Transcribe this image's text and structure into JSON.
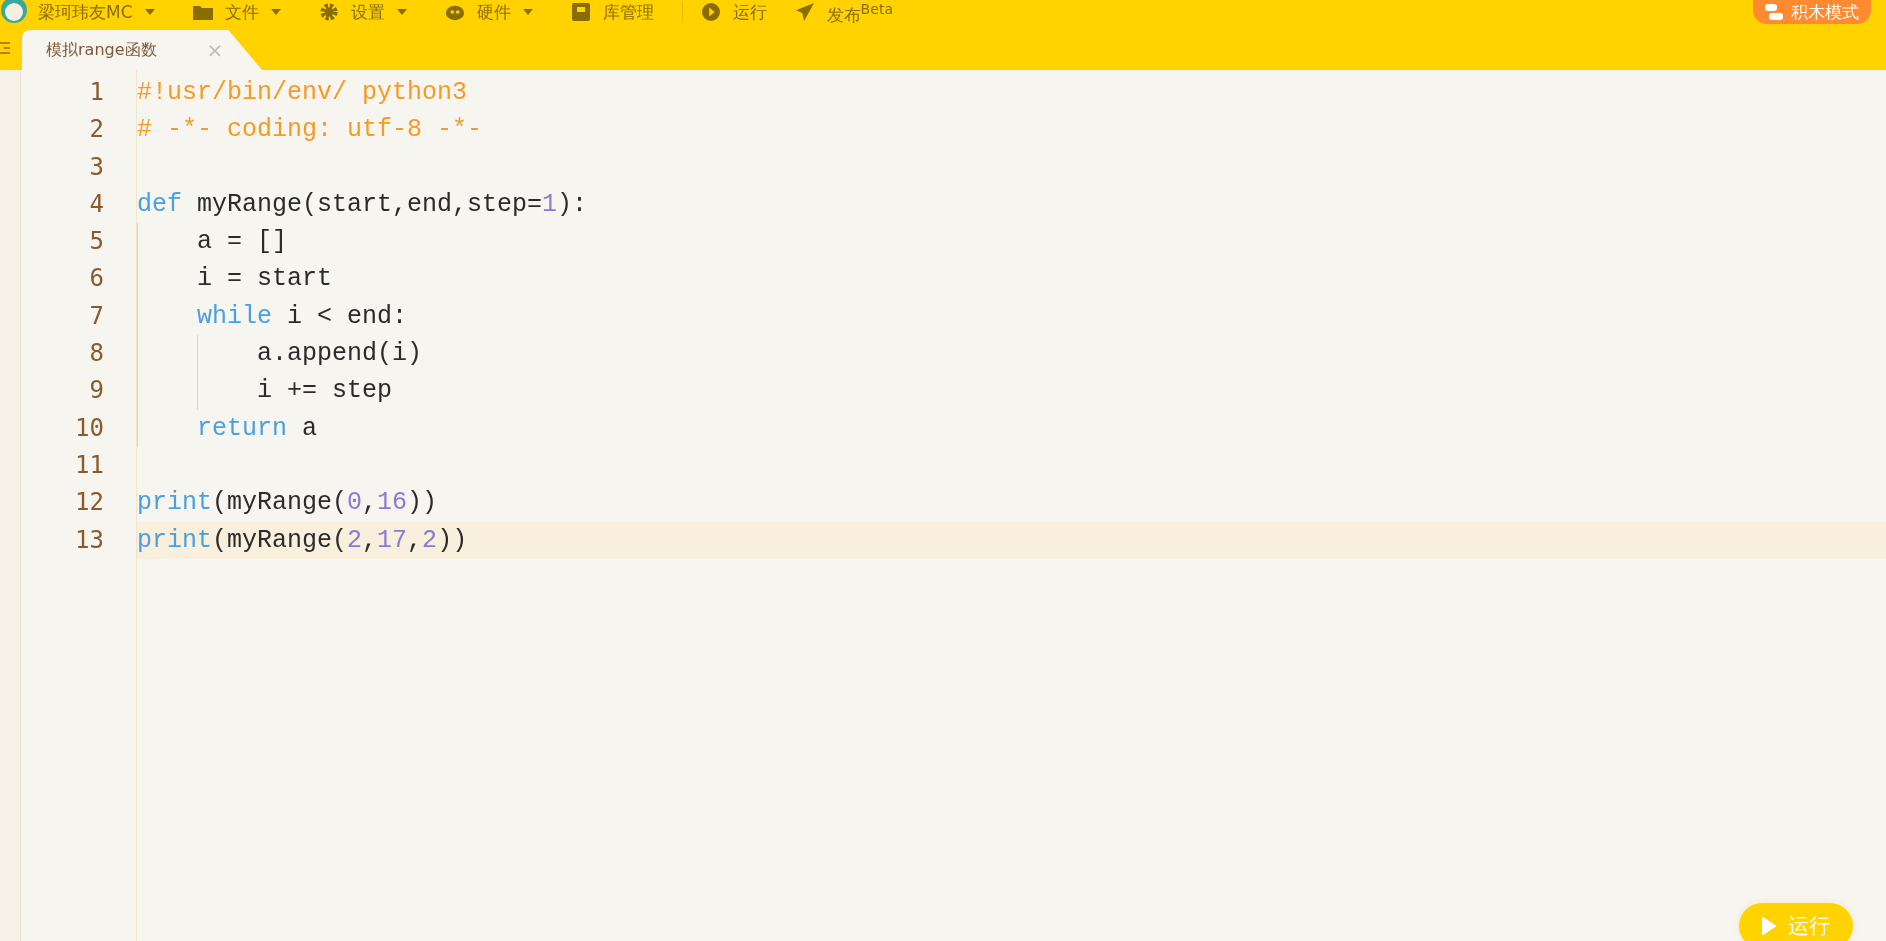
{
  "menu": {
    "user": {
      "label": "梁珂玮友MC",
      "dropdown": true
    },
    "items": [
      {
        "kind": "folder",
        "label": "文件",
        "dropdown": true
      },
      {
        "kind": "gear",
        "label": "设置",
        "dropdown": true
      },
      {
        "kind": "hardware",
        "label": "硬件",
        "dropdown": true
      },
      {
        "kind": "box",
        "label": "库管理",
        "dropdown": false
      },
      {
        "kind": "play",
        "label": "运行",
        "dropdown": false
      },
      {
        "kind": "send",
        "label": "发布$^{Beta}$",
        "dropdown": false
      }
    ],
    "mode_button": "积木模式"
  },
  "tabs": [
    {
      "label": "模拟range函数",
      "selected": true,
      "close": "×"
    }
  ],
  "editor": {
    "lines": [
      {
        "number": "1",
        "current": false,
        "tokens": [
          {
            "kind": "comment",
            "text": "#!usr/bin/env/ python3"
          }
        ]
      },
      {
        "number": "2",
        "current": false,
        "tokens": [
          {
            "kind": "comment",
            "text": "# -*- coding: utf-8 -*-"
          }
        ]
      },
      {
        "number": "3",
        "current": false
      },
      {
        "number": "4",
        "current": false,
        "tokens": [
          {
            "kind": "keyword",
            "text": "def"
          },
          {
            "kind": "plain",
            "text": " myRange(start,end,step="
          },
          {
            "kind": "number",
            "text": "1"
          },
          {
            "kind": "plain",
            "text": "):"
          }
        ]
      },
      {
        "number": "5",
        "current": false,
        "tokens": [
          {
            "kind": "plain",
            "text": "    a = []"
          }
        ]
      },
      {
        "number": "6",
        "current": false,
        "tokens": [
          {
            "kind": "plain",
            "text": "    i = start"
          }
        ]
      },
      {
        "number": "7",
        "current": false,
        "tokens": [
          {
            "kind": "keyword",
            "text": "    while"
          },
          {
            "kind": "plain",
            "text": " i < end:"
          }
        ]
      },
      {
        "number": "8",
        "current": false,
        "tokens": [
          {
            "kind": "plain",
            "text": "        a.append(i)"
          }
        ]
      },
      {
        "number": "9",
        "current": false,
        "tokens": [
          {
            "kind": "plain",
            "text": "        i += step"
          }
        ]
      },
      {
        "number": "10",
        "current": false,
        "tokens": [
          {
            "kind": "keyword",
            "text": "    return"
          },
          {
            "kind": "plain",
            "text": " a"
          }
        ]
      },
      {
        "number": "11",
        "current": false
      },
      {
        "number": "12",
        "current": false,
        "tokens": [
          {
            "kind": "keyword",
            "text": "print"
          },
          {
            "kind": "plain",
            "text": "(myRange("
          },
          {
            "kind": "number",
            "text": "0"
          },
          {
            "kind": "plain",
            "text": ","
          },
          {
            "kind": "number",
            "text": "16"
          },
          {
            "kind": "plain",
            "text": "))"
          }
        ]
      },
      {
        "number": "13",
        "current": true,
        "tokens": [
          {
            "kind": "keyword",
            "text": "print"
          },
          {
            "kind": "plain",
            "text": "(myRange("
          },
          {
            "kind": "number",
            "text": "2"
          },
          {
            "kind": "plain",
            "text": ","
          },
          {
            "kind": "number",
            "text": "17"
          },
          {
            "kind": "plain",
            "text": ","
          },
          {
            "kind": "number",
            "text": "2"
          },
          {
            "kind": "plain",
            "text": "))"
          }
        ]
      }
    ]
  },
  "run_button": "运行"
}
